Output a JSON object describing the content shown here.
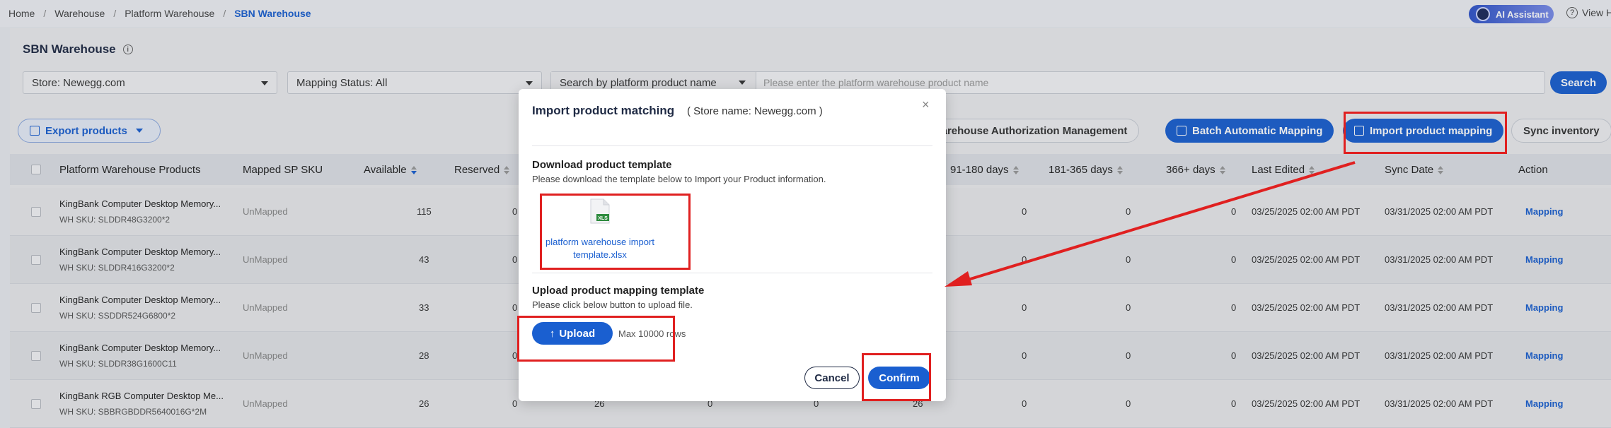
{
  "breadcrumb": [
    "Home",
    "Warehouse",
    "Platform Warehouse"
  ],
  "breadcrumb_current": "SBN Warehouse",
  "header": {
    "ai_label": "AI Assistant",
    "help_label": "View H"
  },
  "page": {
    "title": "SBN Warehouse",
    "info_icon": "i"
  },
  "filters": {
    "store": "Store: Newegg.com",
    "mapping_status": "Mapping Status: All",
    "search_type": "Search by platform product name",
    "search_placeholder": "Please enter the platform warehouse product name",
    "search_button": "Search"
  },
  "toolbar": {
    "export": "Export products",
    "warehouse_auth": "Warehouse Authorization Management",
    "batch_mapping": "Batch Automatic Mapping",
    "import_mapping": "Import product mapping",
    "sync_inventory": "Sync inventory"
  },
  "table": {
    "columns": {
      "product": "Platform Warehouse Products",
      "mapped_sku": "Mapped SP SKU",
      "available": "Available",
      "reserved": "Reserved",
      "d91_180": "91-180 days",
      "d181_365": "181-365 days",
      "d366": "366+ days",
      "last_edited": "Last Edited",
      "sync_date": "Sync Date",
      "action": "Action"
    },
    "rows": [
      {
        "name": "KingBank Computer Desktop Memory...",
        "sku": "WH SKU: SLDDR48G3200*2",
        "mapped": "UnMapped",
        "available": "115",
        "reserved": "0",
        "d91": "0",
        "d181": "0",
        "d366": "0",
        "last_edited": "03/25/2025 02:00 AM PDT",
        "sync": "03/31/2025 02:00 AM PDT",
        "action": "Mapping"
      },
      {
        "name": "KingBank Computer Desktop Memory...",
        "sku": "WH SKU: SLDDR416G3200*2",
        "mapped": "UnMapped",
        "available": "43",
        "reserved": "0",
        "d91": "0",
        "d181": "0",
        "d366": "0",
        "last_edited": "03/25/2025 02:00 AM PDT",
        "sync": "03/31/2025 02:00 AM PDT",
        "action": "Mapping"
      },
      {
        "name": "KingBank Computer Desktop Memory...",
        "sku": "WH SKU: SSDDR524G6800*2",
        "mapped": "UnMapped",
        "available": "33",
        "reserved": "0",
        "d91": "0",
        "d181": "0",
        "d366": "0",
        "last_edited": "03/25/2025 02:00 AM PDT",
        "sync": "03/31/2025 02:00 AM PDT",
        "action": "Mapping"
      },
      {
        "name": "KingBank Computer Desktop Memory...",
        "sku": "WH SKU: SLDDR38G1600C11",
        "mapped": "UnMapped",
        "available": "28",
        "reserved": "0",
        "d91": "0",
        "d181": "0",
        "d366": "0",
        "last_edited": "03/25/2025 02:00 AM PDT",
        "sync": "03/31/2025 02:00 AM PDT",
        "action": "Mapping"
      },
      {
        "name": "KingBank RGB Computer Desktop Me...",
        "sku": "WH SKU: SBBRGBDDR5640016G*2M",
        "mapped": "UnMapped",
        "available": "26",
        "reserved": "0",
        "d91": "0",
        "d181": "0",
        "d366": "0",
        "last_edited": "03/25/2025 02:00 AM PDT",
        "sync": "03/31/2025 02:00 AM PDT",
        "action": "Mapping"
      }
    ],
    "row6_partial": {
      "c1": "26",
      "c2": "0",
      "c3": "0",
      "c4": "26"
    }
  },
  "modal": {
    "title": "Import product matching",
    "store": "( Store name: Newegg.com )",
    "close": "×",
    "download_heading": "Download product template",
    "download_sub": "Please download the template below to Import your Product information.",
    "file_badge": "XLS",
    "file_name_line1": "platform warehouse import",
    "file_name_line2": "template.xlsx",
    "upload_heading": "Upload product mapping template",
    "upload_sub": "Please click below button to upload file.",
    "upload_button": "Upload",
    "max_rows": "Max 10000 rows",
    "cancel": "Cancel",
    "confirm": "Confirm"
  },
  "colors": {
    "primary": "#1a5fd0",
    "annotation": "#e02020"
  }
}
